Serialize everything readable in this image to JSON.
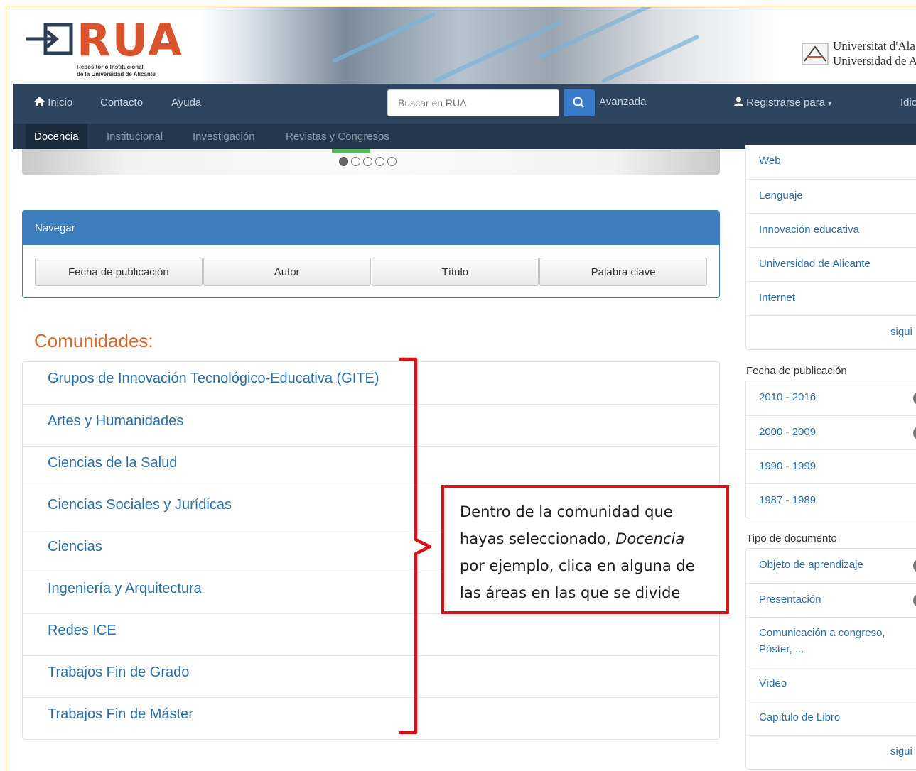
{
  "header": {
    "logo_text": "RUA",
    "logo_subtitle_1": "Repositorio Institucional",
    "logo_subtitle_2": "de la Universidad de Alicante",
    "university_line_1": "Universitat d'Ala",
    "university_line_2": "Universidad de A"
  },
  "navbar": {
    "home_label": "Inicio",
    "contact_label": "Contacto",
    "help_label": "Ayuda",
    "search_placeholder": "Buscar en RUA",
    "advanced_label": "Avanzada",
    "register_label": "Registrarse para",
    "language_label": "Idio"
  },
  "subnav": {
    "items": [
      "Docencia",
      "Institucional",
      "Investigación",
      "Revistas y Congresos"
    ],
    "active": "Docencia"
  },
  "carousel": {
    "dot_count": 5,
    "active_dot": 1
  },
  "browse_panel": {
    "title": "Navegar",
    "buttons": [
      "Fecha de publicación",
      "Autor",
      "Título",
      "Palabra clave"
    ]
  },
  "communities": {
    "title": "Comunidades:",
    "items": [
      "Grupos de Innovación Tecnológico-Educativa (GITE)",
      "Artes y Humanidades",
      "Ciencias de la Salud",
      "Ciencias Sociales y Jurídicas",
      "Ciencias",
      "Ingeniería y Arquitectura",
      "Redes ICE",
      "Trabajos Fin de Grado",
      "Trabajos Fin de Máster"
    ]
  },
  "callout": {
    "text_before": "Dentro de la comunidad que hayas seleccionado, ",
    "emphasis": "Docencia",
    "text_after": " por ejemplo, clica en alguna de las áreas en las que se divide",
    "border_color": "#dd1018"
  },
  "sidebar": {
    "keywords": {
      "items": [
        "Web",
        "Lenguaje",
        "Innovación educativa",
        "Universidad de Alicante",
        "Internet"
      ],
      "more_label": "sigui"
    },
    "date_facet": {
      "title": "Fecha de publicación",
      "items": [
        "2010 - 2016",
        "2000 - 2009",
        "1990 - 1999",
        "1987 - 1989"
      ]
    },
    "type_facet": {
      "title": "Tipo de documento",
      "items": [
        "Objeto de aprendizaje",
        "Presentación",
        "Comunicación a congreso, Póster, ...",
        "Vídeo",
        "Capítulo de Libro"
      ],
      "more_label": "sigui"
    }
  },
  "colors": {
    "navbar": "#2e4560",
    "subnav": "#24384f",
    "panel_header": "#3d7ebf",
    "link": "#2a6fa8",
    "communities_title": "#d9682c",
    "logo": "#d9532c"
  }
}
